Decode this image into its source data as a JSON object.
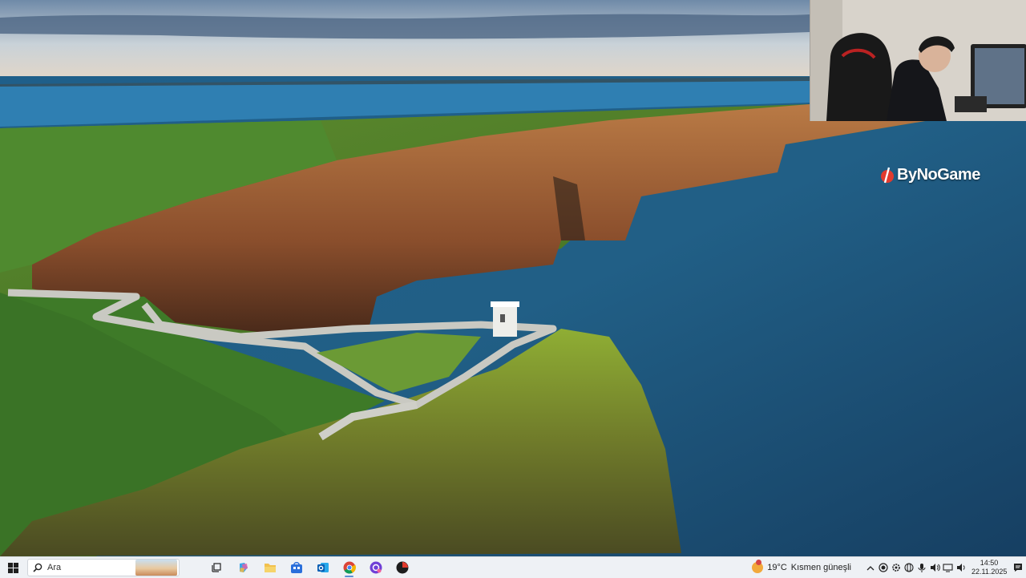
{
  "desktop": {
    "wallpaper": "cliffs-of-moher",
    "overlay_logo": "ByNoGame"
  },
  "taskbar": {
    "search_placeholder": "Ara",
    "apps": [
      {
        "name": "task-view",
        "icon": "task-view-icon"
      },
      {
        "name": "copilot",
        "icon": "copilot-icon"
      },
      {
        "name": "file-explorer",
        "icon": "folder-icon"
      },
      {
        "name": "microsoft-store",
        "icon": "store-icon"
      },
      {
        "name": "outlook",
        "icon": "outlook-icon"
      },
      {
        "name": "chrome",
        "icon": "chrome-icon",
        "active": true
      },
      {
        "name": "app-purple",
        "icon": "purple-app-icon"
      },
      {
        "name": "app-red",
        "icon": "red-app-icon"
      }
    ],
    "weather": {
      "temp": "19°C",
      "condition": "Kısmen güneşli"
    },
    "clock": {
      "time": "14:50",
      "date": "22.11.2025"
    },
    "colors": {
      "accent": "#5b8fd6",
      "taskbar_bg": "#eef1f5"
    }
  }
}
